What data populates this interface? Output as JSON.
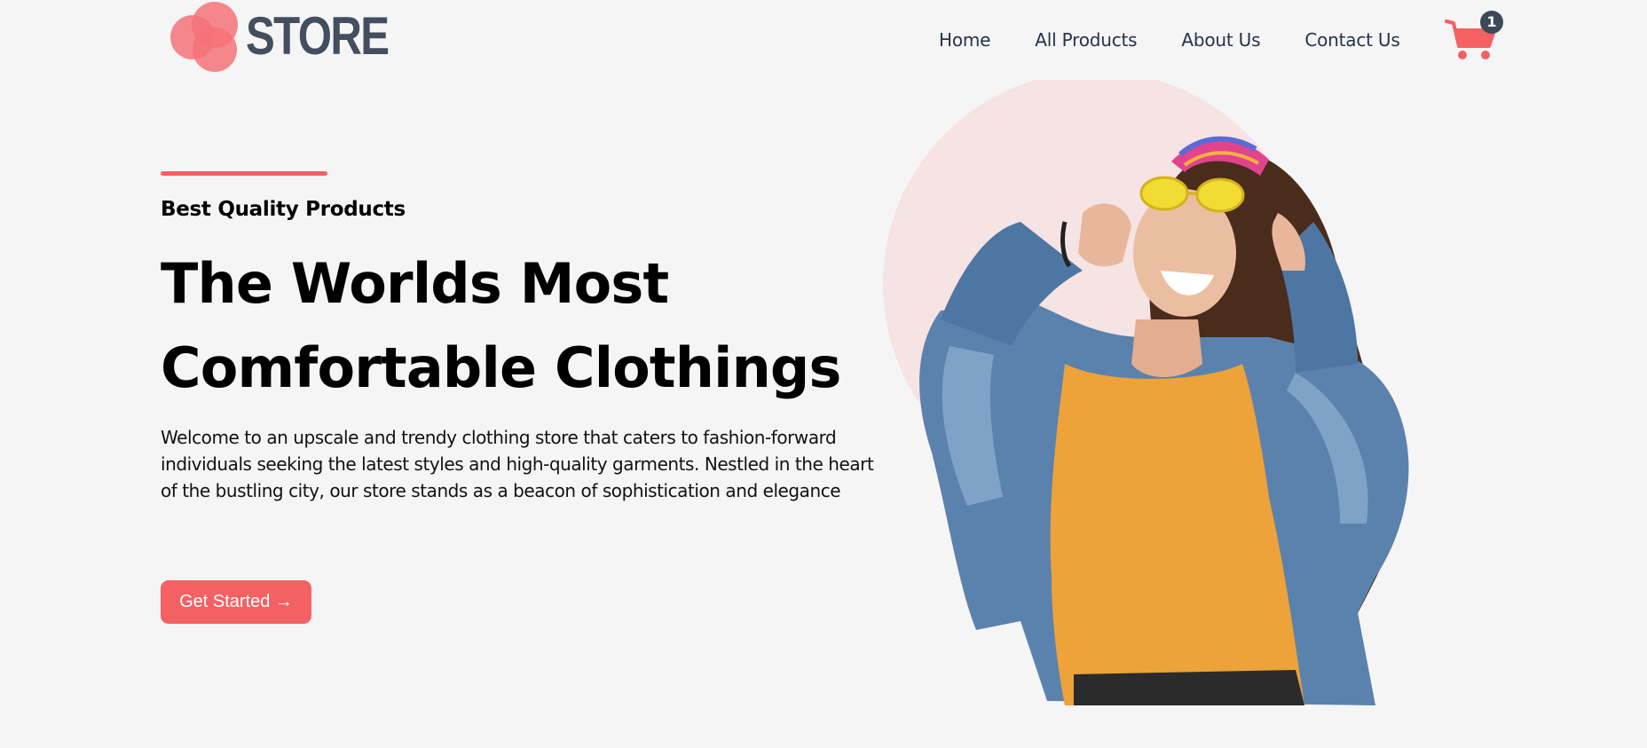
{
  "brand": {
    "logo_text": "STORE",
    "colors": {
      "accent": "#f46163",
      "logo_circle": "#f47278",
      "logo_text": "#434e5e",
      "hero_circle": "#f6e3e4",
      "page_bg": "#f5f5f5"
    }
  },
  "nav": {
    "items": [
      {
        "label": "Home"
      },
      {
        "label": "All Products"
      },
      {
        "label": "About Us"
      },
      {
        "label": "Contact Us"
      }
    ]
  },
  "cart": {
    "icon": "shopping-cart-icon",
    "count": "1"
  },
  "hero": {
    "eyebrow": "Best Quality Products",
    "headline_line1": "The Worlds Most",
    "headline_line2": "Comfortable Clothings",
    "description": "Welcome to an upscale and trendy clothing store that caters to fashion-forward individuals seeking the latest styles and high-quality garments. Nestled in the heart of the bustling city, our store stands as a beacon of sophistication and elegance",
    "cta_label": "Get Started →",
    "image_subject": "woman-in-denim-jacket"
  }
}
